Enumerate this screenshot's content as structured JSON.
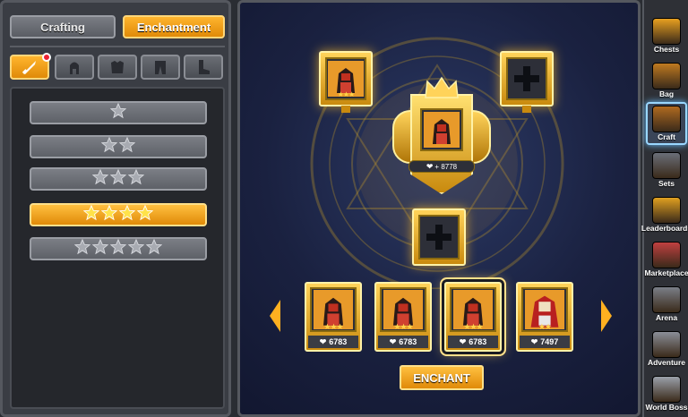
{
  "tabs": {
    "crafting": "Crafting",
    "enchantment": "Enchantment"
  },
  "categories": [
    {
      "icon": "sword-icon",
      "active": true,
      "notification": true
    },
    {
      "icon": "helmet-icon",
      "active": false
    },
    {
      "icon": "chestplate-icon",
      "active": false
    },
    {
      "icon": "legs-icon",
      "active": false
    },
    {
      "icon": "boots-icon",
      "active": false
    }
  ],
  "enchant_levels": [
    {
      "stars": 1,
      "selected": false
    },
    {
      "stars": 2,
      "selected": false
    },
    {
      "stars": 3,
      "selected": false
    },
    {
      "stars": 4,
      "selected": true
    },
    {
      "stars": 5,
      "selected": false
    }
  ],
  "forge": {
    "result_power": "+ 8778",
    "result_power_icon": "heart-icon",
    "top_left_slot": "filled",
    "top_right_slot": "empty",
    "bottom_slot": "empty"
  },
  "heroes": [
    {
      "power": "6783",
      "stars": "★★★",
      "selected": false
    },
    {
      "power": "6783",
      "stars": "★★★",
      "selected": false
    },
    {
      "power": "6783",
      "stars": "★★★",
      "selected": true
    },
    {
      "power": "7497",
      "stars": "★★",
      "selected": false
    }
  ],
  "enchant_button": "ENCHANT",
  "nav": [
    {
      "label": "Chests",
      "icon": "chest-icon",
      "color": "#e8a020"
    },
    {
      "label": "Bag",
      "icon": "bag-icon",
      "color": "#c07a20"
    },
    {
      "label": "Craft",
      "icon": "book-icon",
      "color": "#b06a20",
      "active": true
    },
    {
      "label": "Sets",
      "icon": "armor-icon",
      "color": "#6a6e78"
    },
    {
      "label": "Leaderboards",
      "icon": "podium-icon",
      "color": "#e0a020"
    },
    {
      "label": "Marketplace",
      "icon": "market-icon",
      "color": "#c04040"
    },
    {
      "label": "Arena",
      "icon": "arena-icon",
      "color": "#7a7e88"
    },
    {
      "label": "Adventure",
      "icon": "adventure-icon",
      "color": "#8a8e98"
    },
    {
      "label": "World Boss",
      "icon": "boss-icon",
      "color": "#9aa0aa"
    }
  ],
  "colors": {
    "accent": "#f0a020",
    "panel": "#3a3d44",
    "gold": "#ffd35a"
  }
}
